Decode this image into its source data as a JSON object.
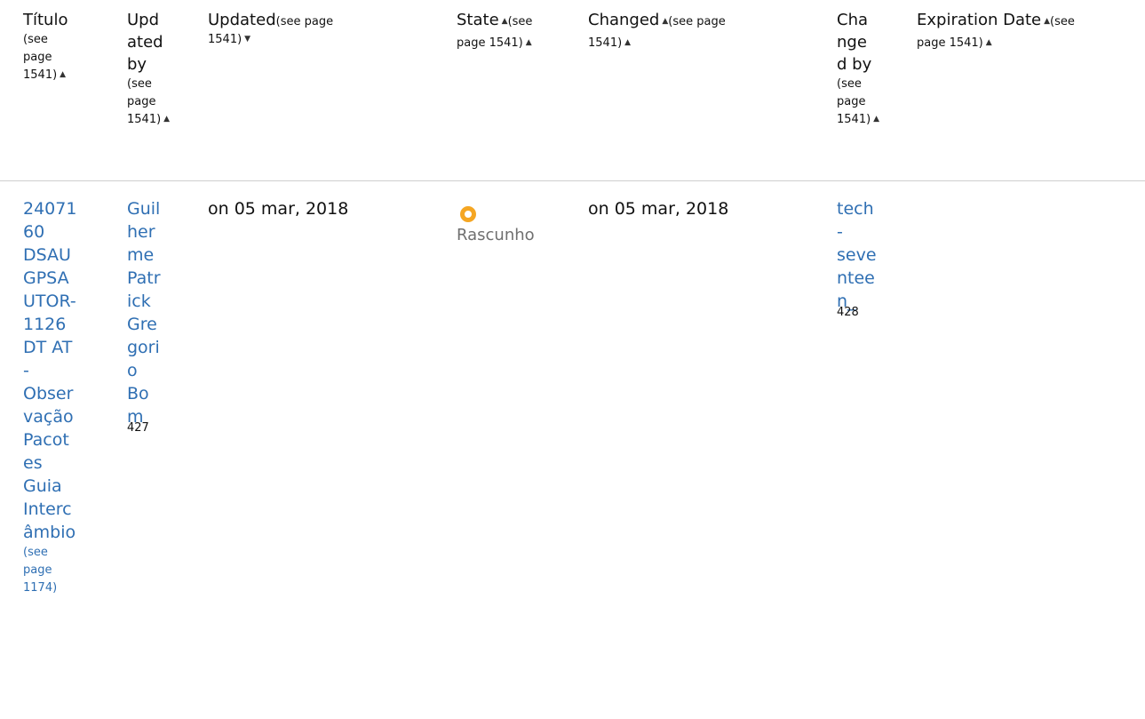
{
  "headers": {
    "titulo": {
      "label": "Título",
      "ref_lines": [
        "(see",
        "page",
        "1541)"
      ]
    },
    "updated_by": {
      "label_lines": [
        "Upd",
        "ated",
        "by"
      ],
      "ref_lines": [
        "(see",
        "page",
        "1541)"
      ]
    },
    "updated": {
      "label": "Updated",
      "ref_inline": "(see page",
      "ref_line2": "1541)"
    },
    "state": {
      "label": "State",
      "ref_inline": "(see",
      "ref_line2": "page 1541)"
    },
    "changed": {
      "label": "Changed",
      "ref_inline": "(see page",
      "ref_line2": "1541)"
    },
    "changed_by": {
      "label_lines": [
        "Cha",
        "nge",
        "d by"
      ],
      "ref_lines": [
        "(see",
        "page",
        "1541)"
      ]
    },
    "expiration": {
      "label": "Expiration Date",
      "ref_inline": "(see",
      "ref_line2": "page 1541)"
    }
  },
  "row": {
    "titulo_lines": [
      "24071",
      "60",
      "DSAU",
      "GPSA",
      "UTOR-",
      "1126",
      "DT AT",
      "-",
      "Obser",
      "vação",
      "Pacot",
      "es",
      "Guia",
      "Interc",
      "âmbio"
    ],
    "titulo_ref_lines": [
      "(see",
      "page",
      "1174)"
    ],
    "updated_by_lines": [
      "Guil",
      "her",
      "me",
      "Patr",
      "ick",
      "Gre",
      "gori",
      "o",
      "Bo",
      "m"
    ],
    "updated_by_sup": "427",
    "updated": "on 05 mar, 2018",
    "state": "Rascunho",
    "changed": "on 05 mar, 2018",
    "changed_by_lines": [
      "tech",
      "-",
      "seve",
      "ntee",
      "n_"
    ],
    "changed_by_sup": "428"
  },
  "colors": {
    "link": "#2f6fb3",
    "state_dot": "#f5a623",
    "divider": "#cfcfcf"
  }
}
